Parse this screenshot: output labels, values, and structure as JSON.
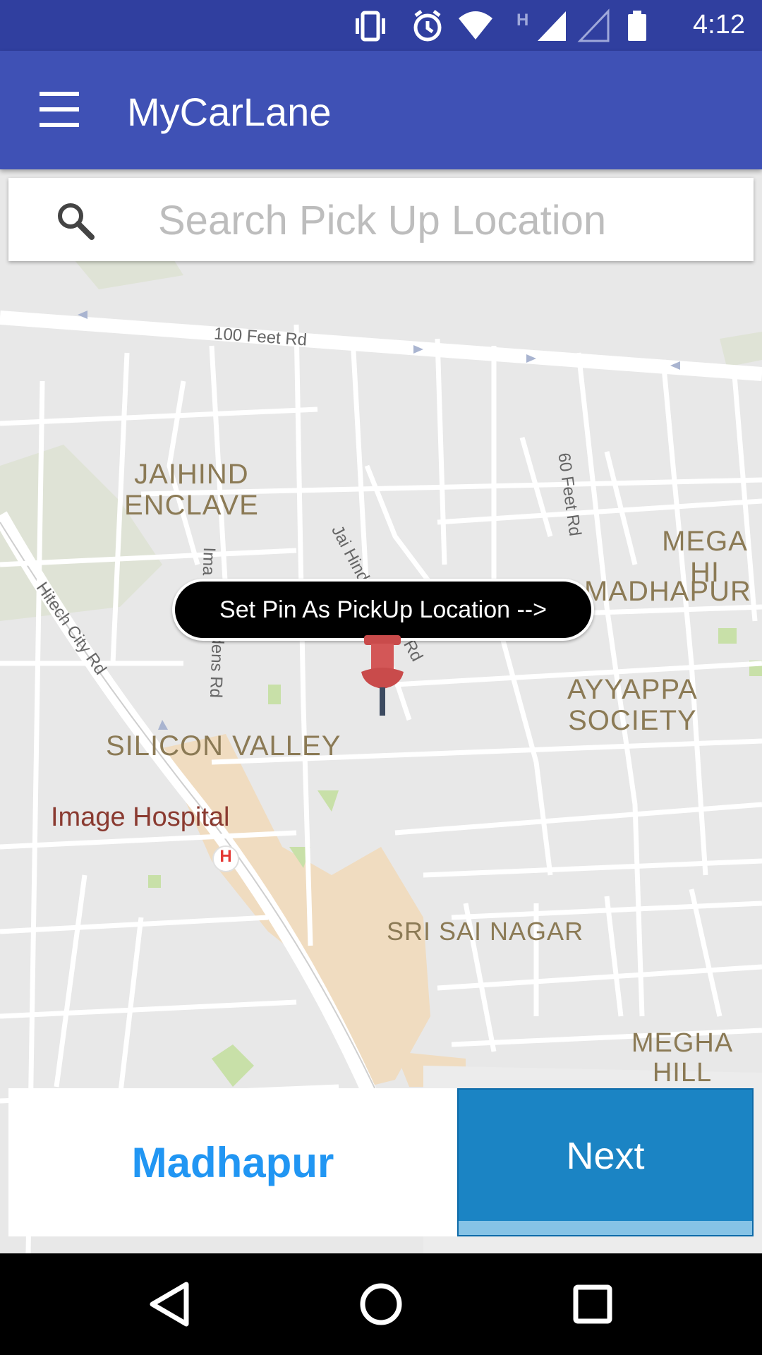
{
  "status_bar": {
    "time": "4:12",
    "icons": [
      "vibrate-icon",
      "alarm-icon",
      "wifi-icon",
      "h-network-icon",
      "signal-icon",
      "signal-empty-icon",
      "battery-icon"
    ]
  },
  "app_bar": {
    "menu_icon": "menu-icon",
    "title": "MyCarLane"
  },
  "search": {
    "icon": "search-icon",
    "placeholder": "Search Pick Up Location",
    "value": ""
  },
  "map": {
    "area_labels": {
      "jaihind": "JAIHIND\nENCLAVE",
      "silicon": "SILICON VALLEY",
      "ayyappa": "AYYAPPA\nSOCIETY",
      "madhapur": "MADHAPUR",
      "mega_hills_top": "MEGA HI",
      "sri_sai": "SRI SAI NAGAR",
      "megha_hills": "MEGHA HILL"
    },
    "road_labels": {
      "feet100": "100 Feet Rd",
      "feet60": "60 Feet Rd",
      "hitech": "Hitech City Rd",
      "jaihind_rd": "Jai Hind",
      "rd_end": "Rd",
      "imag": "Ima",
      "dens": "dens Rd"
    },
    "poi": {
      "hospital_name": "Image Hospital",
      "hospital_marker": "H"
    },
    "tooltip": "Set Pin As PickUp Location -->",
    "pin_icon": "map-pin-icon",
    "fab_icon": "location-disabled-icon"
  },
  "bottom": {
    "location": "Madhapur",
    "next_label": "Next"
  },
  "nav_bar": {
    "back": "back-icon",
    "home": "home-icon",
    "recents": "recents-icon"
  },
  "colors": {
    "status_bar": "#303f9f",
    "app_bar": "#3f51b5",
    "fab": "#ff4081",
    "next_button": "#1b84c4",
    "location_text": "#2196f3",
    "pin": "#c94b4b"
  }
}
